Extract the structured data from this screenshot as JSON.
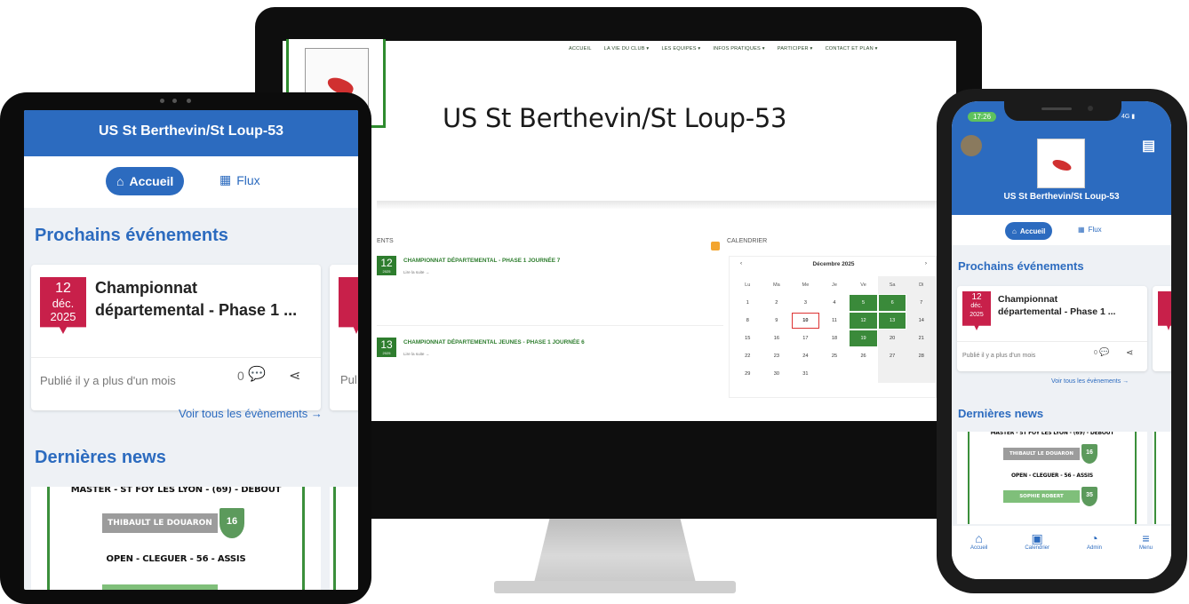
{
  "club_name": "US St Berthevin/St Loup-53",
  "website": {
    "nav": [
      "ACCUEIL",
      "LA VIE DU CLUB ▾",
      "LES EQUIPES ▾",
      "INFOS PRATIQUES ▾",
      "PARTICIPER ▾",
      "CONTACT ET PLAN ▾"
    ],
    "title": "US St Berthevin/St Loup-53",
    "events_label": "ENTS",
    "events": [
      {
        "day": "12",
        "year": "2025",
        "title": "CHAMPIONNAT DÉPARTEMENTAL - PHASE 1 JOURNÉE 7",
        "more": "Lire la suite →"
      },
      {
        "day": "13",
        "year": "2025",
        "title": "CHAMPIONNAT DÉPARTEMENTAL JEUNES - PHASE 1 JOURNÉE 6",
        "more": "Lire la suite →"
      }
    ],
    "calendar": {
      "label": "CALENDRIER",
      "month": "Décembre 2025",
      "prev": "‹",
      "next": "›",
      "weekdays": [
        "Lu",
        "Ma",
        "Me",
        "Je",
        "Ve",
        "Sa",
        "Di"
      ],
      "weeks": [
        [
          "1",
          "2",
          "3",
          "4",
          "5",
          "6",
          "7"
        ],
        [
          "8",
          "9",
          "10",
          "11",
          "12",
          "13",
          "14"
        ],
        [
          "15",
          "16",
          "17",
          "18",
          "19",
          "20",
          "21"
        ],
        [
          "22",
          "23",
          "24",
          "25",
          "26",
          "27",
          "28"
        ],
        [
          "29",
          "30",
          "31",
          "",
          "",
          "",
          ""
        ]
      ],
      "event_days": [
        "5",
        "6",
        "12",
        "13",
        "19"
      ],
      "today": "10"
    }
  },
  "app": {
    "header_title": "US St Berthevin/St Loup-53",
    "tab_home": "Accueil",
    "tab_feed": "Flux",
    "upcoming_title": "Prochains événements",
    "event": {
      "day": "12",
      "month": "déc.",
      "year": "2025",
      "title_line1": "Championnat",
      "title_line2": "départemental - Phase 1 ...",
      "published": "Publié il y a plus d'un mois",
      "comments": "0"
    },
    "partial_published": "Pul",
    "see_all": "Voir tous les évènements →",
    "news_title": "Dernières news",
    "news_lines": {
      "line1": "MASTER - ST FOY LES LYON - (69) - DEBOUT",
      "banner1": "THIBAULT LE DOUARON",
      "shield1": "16",
      "line2": "OPEN - CLEGUER - 56 - ASSIS",
      "banner2": "SOPHIE ROBERT",
      "shield2": "35"
    },
    "phone_status_time": "17:26",
    "phone_status_right": "4G ▮",
    "phone_see_all": "Voir tous les évènements →",
    "phone_event_title_line2": "départemental - Phase 1 ...",
    "phone_published": "Publié il y a plus d'un mois",
    "bottom_nav": [
      "Accueil",
      "Calendrier",
      "Admin",
      "Menu"
    ]
  },
  "colors": {
    "brand_blue": "#2c6bbf",
    "badge_red": "#c8204a",
    "calendar_green": "#3a8a3a"
  }
}
